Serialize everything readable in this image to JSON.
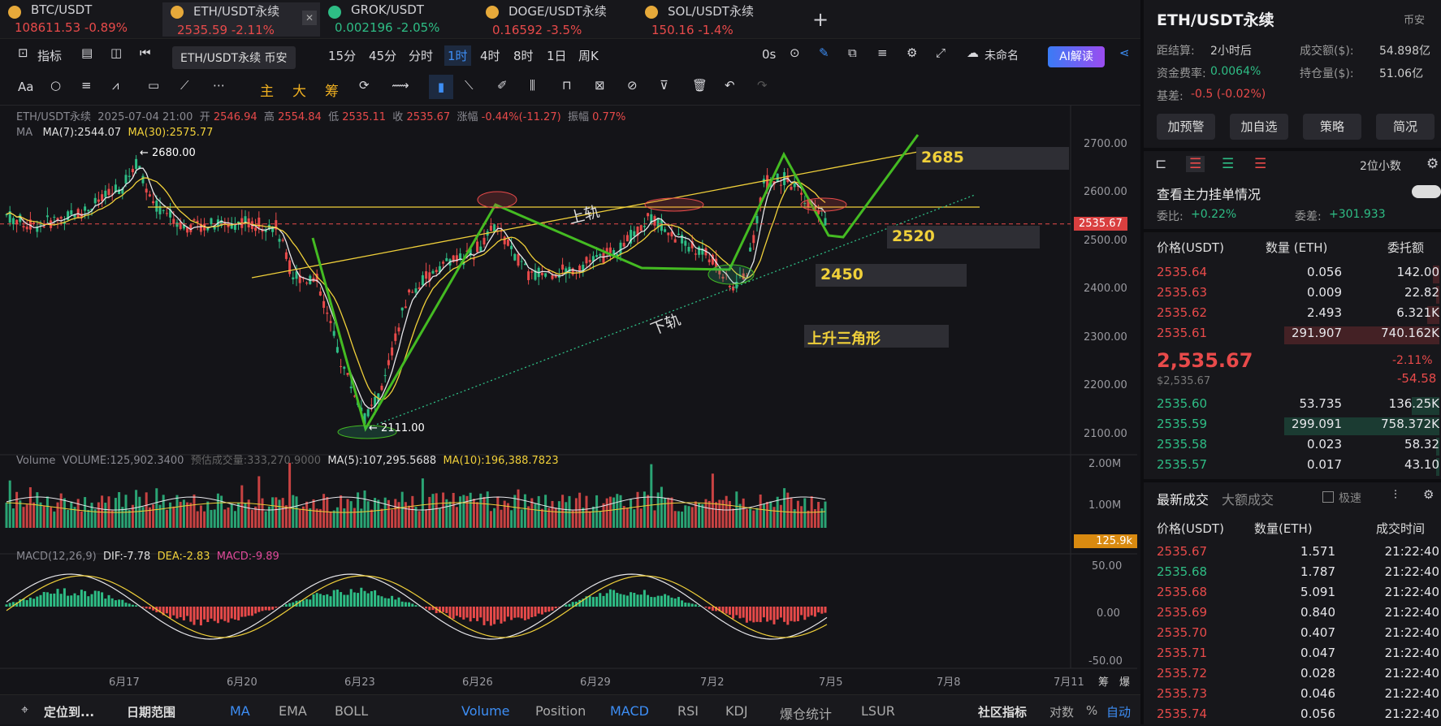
{
  "tabs": [
    {
      "name": "BTC/USDT",
      "price": "108611.53",
      "change": "-0.89%",
      "color": "red"
    },
    {
      "name": "ETH/USDT永续",
      "price": "2535.59",
      "change": "-2.11%",
      "color": "red"
    },
    {
      "name": "GROK/USDT",
      "price": "0.002196",
      "change": "-2.05%",
      "color": "grn"
    },
    {
      "name": "DOGE/USDT永续",
      "price": "0.16592",
      "change": "-3.5%",
      "color": "red"
    },
    {
      "name": "SOL/USDT永续",
      "price": "150.16",
      "change": "-1.4%",
      "color": "red"
    }
  ],
  "toolbar": {
    "indicator": "指标",
    "tooltip": "ETH/USDT永续 币安",
    "intervals": [
      "15分",
      "45分",
      "分时",
      "1时",
      "4时",
      "8时",
      "1日",
      "周K"
    ],
    "active_interval": "1时",
    "countdown": "0s",
    "layout_name": "未命名",
    "ai": "AI解读"
  },
  "drawbar": {
    "font": "Aa",
    "labels": [
      "主",
      "大",
      "筹"
    ]
  },
  "ohlc": {
    "symbol": "ETH/USDT永续",
    "time": "2025-07-04 21:00",
    "open_l": "开",
    "open": "2546.94",
    "high_l": "高",
    "high": "2554.84",
    "low_l": "低",
    "low": "2535.11",
    "close_l": "收",
    "close": "2535.67",
    "chg_l": "涨幅",
    "chg": "-0.44%(-11.27)",
    "amp_l": "振幅",
    "amp": "0.77%"
  },
  "ma": {
    "label": "MA",
    "ma7": "MA(7):2544.07",
    "ma30": "MA(30):2575.77"
  },
  "annot": {
    "high": "2680.00",
    "low": "2111.00",
    "upper": "上轨",
    "lower": "下轨",
    "t2685": "2685",
    "t2520": "2520",
    "t2450": "2450",
    "pattern": "上升三角形"
  },
  "price_axis": [
    "2700.00",
    "2600.00",
    "2500.00",
    "2400.00",
    "2300.00",
    "2200.00",
    "2100.00"
  ],
  "last_price": "2535.67",
  "volume": {
    "label": "Volume",
    "v": "VOLUME:125,902.3400",
    "est": "预估成交量:333,270.9000",
    "ma5": "MA(5):107,295.5688",
    "ma10": "MA(10):196,388.7823",
    "axis": [
      "2.00M",
      "1.00M"
    ],
    "last": "125.9k"
  },
  "macd": {
    "label": "MACD(12,26,9)",
    "dif": "DIF:-7.78",
    "dea": "DEA:-2.83",
    "macd": "MACD:-9.89",
    "axis": [
      "50.00",
      "0.00",
      "-50.00"
    ]
  },
  "dates": [
    "6月17",
    "6月20",
    "6月23",
    "6月26",
    "6月29",
    "7月2",
    "7月5",
    "7月8",
    "7月11"
  ],
  "date_extra": [
    "筹",
    "爆"
  ],
  "bottom": {
    "locate": "定位到...",
    "range": "日期范围",
    "items": [
      "MA",
      "EMA",
      "BOLL",
      "Volume",
      "Position",
      "MACD",
      "RSI",
      "KDJ",
      "爆仓统计",
      "LSUR"
    ],
    "community": "社区指标",
    "log": "对数",
    "pct": "%",
    "auto": "自动"
  },
  "right": {
    "title": "ETH/USDT永续",
    "exchange": "币安",
    "settle_l": "距结算:",
    "settle": "2小时后",
    "turnover_l": "成交额($):",
    "turnover": "54.898亿",
    "fund_l": "资金费率:",
    "fund": "0.0064%",
    "oi_l": "持仓量($):",
    "oi": "51.06亿",
    "basis_l": "基差:",
    "basis": "-0.5 (-0.02%)",
    "buttons": [
      "加预警",
      "加自选",
      "策略",
      "简况"
    ],
    "decimals": "2位小数",
    "depth_link": "查看主力挂单情况",
    "ratio_l": "委比:",
    "ratio": "+0.22%",
    "diff_l": "委差:",
    "diff": "+301.933",
    "book_hdr": [
      "价格(USDT)",
      "数量 (ETH)",
      "委托额"
    ],
    "asks": [
      [
        "2535.64",
        "0.056",
        "142.00",
        4
      ],
      [
        "2535.63",
        "0.009",
        "22.82",
        2
      ],
      [
        "2535.62",
        "2.493",
        "6.321K",
        8
      ],
      [
        "2535.61",
        "291.907",
        "740.162K",
        100
      ]
    ],
    "mid": "2,535.67",
    "mid_usd": "$2,535.67",
    "mid_pct": "-2.11%",
    "mid_chg": "-54.58",
    "bids": [
      [
        "2535.60",
        "53.735",
        "136.25K",
        18
      ],
      [
        "2535.59",
        "299.091",
        "758.372K",
        100
      ],
      [
        "2535.58",
        "0.023",
        "58.32",
        2
      ],
      [
        "2535.57",
        "0.017",
        "43.10",
        2
      ]
    ],
    "trade_tabs": [
      "最新成交",
      "大额成交"
    ],
    "fast": "极速",
    "trade_hdr": [
      "价格(USDT)",
      "数量(ETH)",
      "成交时间"
    ],
    "trades": [
      [
        "2535.67",
        "1.571",
        "21:22:40",
        "red"
      ],
      [
        "2535.68",
        "1.787",
        "21:22:40",
        "grn"
      ],
      [
        "2535.68",
        "5.091",
        "21:22:40",
        "red"
      ],
      [
        "2535.69",
        "0.840",
        "21:22:40",
        "red"
      ],
      [
        "2535.70",
        "0.407",
        "21:22:40",
        "red"
      ],
      [
        "2535.71",
        "0.047",
        "21:22:40",
        "red"
      ],
      [
        "2535.72",
        "0.028",
        "21:22:40",
        "red"
      ],
      [
        "2535.73",
        "0.046",
        "21:22:40",
        "red"
      ],
      [
        "2535.74",
        "0.056",
        "21:22:40",
        "red"
      ]
    ]
  }
}
